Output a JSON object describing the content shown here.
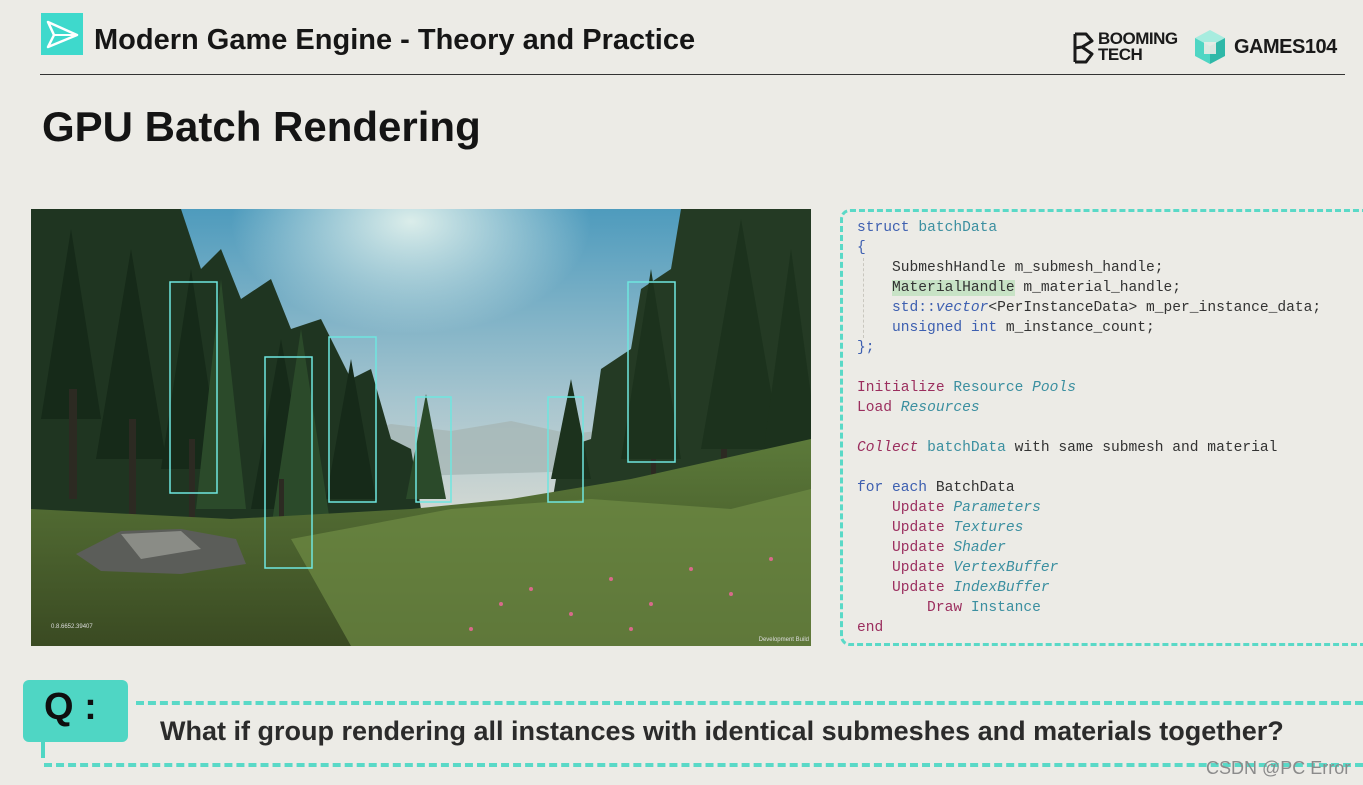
{
  "header": {
    "title": "Modern Game Engine - Theory and Practice",
    "booming_logo_text": [
      "BOOMING",
      "TECH"
    ],
    "games_logo_text": "GAMES104"
  },
  "slide": {
    "title": "GPU Batch Rendering"
  },
  "scene": {
    "version_text": "0.8.6652.39407",
    "build_text": "Development Build"
  },
  "code_lines": [
    [
      {
        "t": "struct ",
        "c": "k"
      },
      {
        "t": "batchData",
        "c": "t"
      }
    ],
    [
      {
        "t": "{",
        "c": "k"
      }
    ],
    [
      {
        "t": "    SubmeshHandle m_submesh_handle;",
        "c": ""
      }
    ],
    [
      {
        "t": "    ",
        "c": ""
      },
      {
        "t": "MaterialHandle",
        "c": "hl"
      },
      {
        "t": " m_material_handle;",
        "c": ""
      }
    ],
    [
      {
        "t": "    std::",
        "c": "k"
      },
      {
        "t": "vector",
        "c": "k i"
      },
      {
        "t": "<PerInstanceData> m_per_instance_data;",
        "c": ""
      }
    ],
    [
      {
        "t": "    unsigned int ",
        "c": "k"
      },
      {
        "t": "m_instance_count;",
        "c": ""
      }
    ],
    [
      {
        "t": "};",
        "c": "k"
      }
    ],
    [
      {
        "t": "",
        "c": ""
      }
    ],
    [
      {
        "t": "Initialize ",
        "c": "p"
      },
      {
        "t": "Resource ",
        "c": "t"
      },
      {
        "t": "Pools",
        "c": "t i"
      }
    ],
    [
      {
        "t": "Load ",
        "c": "p"
      },
      {
        "t": "Resources",
        "c": "t i"
      }
    ],
    [
      {
        "t": "",
        "c": ""
      }
    ],
    [
      {
        "t": "Collect ",
        "c": "p i"
      },
      {
        "t": "batchData ",
        "c": "t"
      },
      {
        "t": "with same submesh and material",
        "c": ""
      }
    ],
    [
      {
        "t": "",
        "c": ""
      }
    ],
    [
      {
        "t": "for each ",
        "c": "k"
      },
      {
        "t": "BatchData",
        "c": ""
      }
    ],
    [
      {
        "t": "    Update ",
        "c": "p"
      },
      {
        "t": "Parameters",
        "c": "t i"
      }
    ],
    [
      {
        "t": "    Update ",
        "c": "p"
      },
      {
        "t": "Textures",
        "c": "t i"
      }
    ],
    [
      {
        "t": "    Update ",
        "c": "p"
      },
      {
        "t": "Shader",
        "c": "t i"
      }
    ],
    [
      {
        "t": "    Update ",
        "c": "p"
      },
      {
        "t": "VertexBuffer",
        "c": "t i"
      }
    ],
    [
      {
        "t": "    Update ",
        "c": "p"
      },
      {
        "t": "IndexBuffer",
        "c": "t i"
      }
    ],
    [
      {
        "t": "        Draw ",
        "c": "p"
      },
      {
        "t": "Instance",
        "c": "t"
      }
    ],
    [
      {
        "t": "end",
        "c": "p"
      }
    ]
  ],
  "question": {
    "label": "Q :",
    "text": "What if group rendering all instances with identical submeshes and materials together?"
  },
  "watermark": "CSDN @PC Error",
  "colors": {
    "accent": "#4fd6c4",
    "background": "#ecebe6",
    "keyword": "#3d5fb0",
    "type": "#3b8fa0",
    "procedure": "#9b2e5e"
  }
}
